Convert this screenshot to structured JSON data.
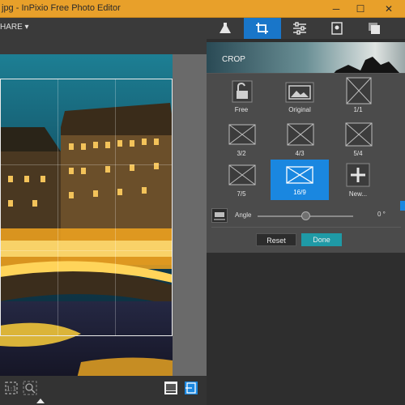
{
  "window": {
    "title": "jpg - InPixio Free Photo Editor",
    "minimize_glyph": "─",
    "maximize_glyph": "☐",
    "close_glyph": "✕"
  },
  "toolbar": {
    "share_label": "HARE ▾"
  },
  "tabs": [
    {
      "icon": "flask-icon"
    },
    {
      "icon": "crop-icon",
      "active": true
    },
    {
      "icon": "sliders-icon"
    },
    {
      "icon": "frame-icon"
    },
    {
      "icon": "layers-icon"
    }
  ],
  "crop": {
    "banner_label": "CROP",
    "presets": [
      {
        "label": "Free",
        "icon": "unlock-icon"
      },
      {
        "label": "Original",
        "icon": "image-icon"
      },
      {
        "label": "1/1"
      },
      {
        "label": "3/2"
      },
      {
        "label": "4/3"
      },
      {
        "label": "5/4"
      },
      {
        "label": "7/5"
      },
      {
        "label": "16/9",
        "selected": true
      },
      {
        "label": "New...",
        "icon": "plus-icon"
      }
    ],
    "angle_label": "Angle",
    "angle_value": "0 °",
    "angle_level": 0.5,
    "reset_label": "Reset",
    "done_label": "Done"
  },
  "colors": {
    "title_bar": "#e8a02a",
    "accent": "#1a87e0",
    "done": "#1f9aa6"
  }
}
